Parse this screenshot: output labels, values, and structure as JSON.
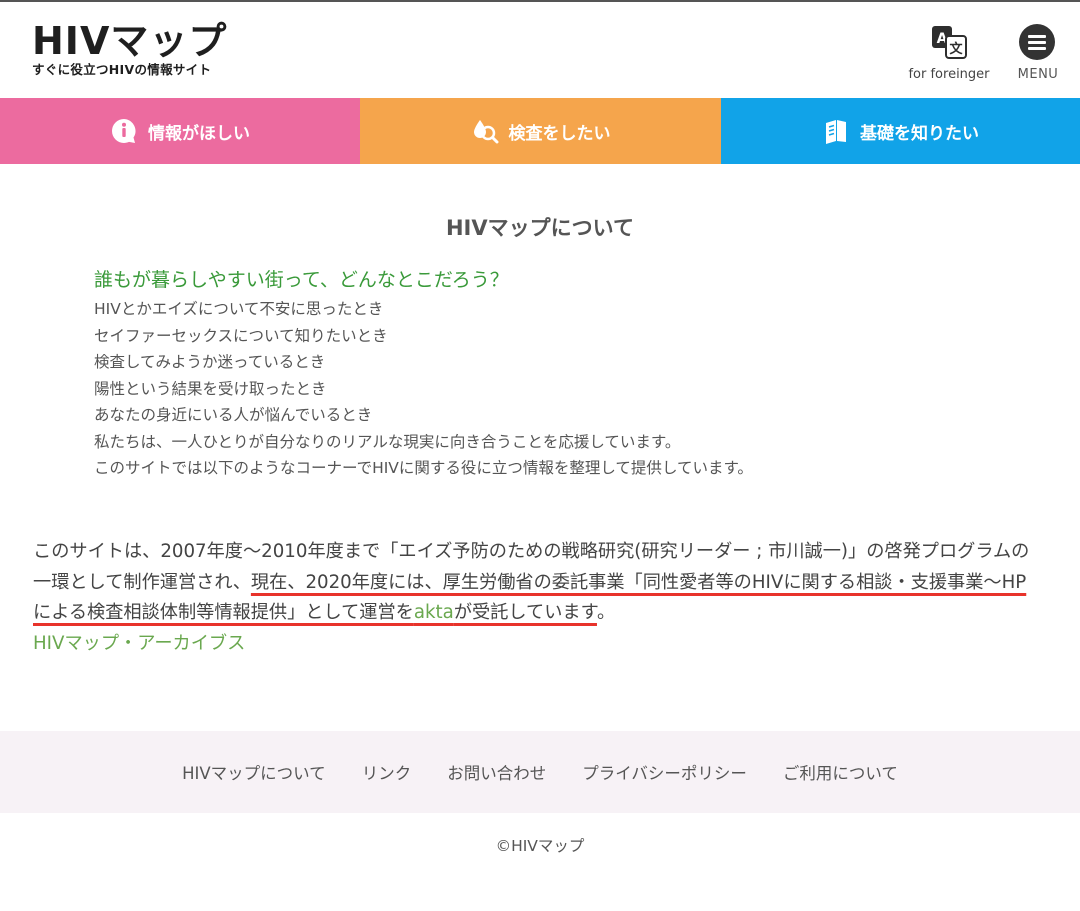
{
  "header": {
    "logo_main": "HIVマップ",
    "logo_sub": "すぐに役立つHIVの情報サイト",
    "lang_label": "for foreinger",
    "menu_label": "MENU"
  },
  "nav": {
    "tabs": [
      {
        "label": "情報がほしい",
        "color": "#ec6b9f",
        "icon": "info-icon"
      },
      {
        "label": "検査をしたい",
        "color": "#f5a54c",
        "icon": "test-search-icon"
      },
      {
        "label": "基礎を知りたい",
        "color": "#11a3e8",
        "icon": "book-icon"
      }
    ]
  },
  "main": {
    "title": "HIVマップについて",
    "intro_heading": "誰もが暮らしやすい街って、どんなとこだろう？",
    "intro_lines": [
      "HIVとかエイズについて不安に思ったとき",
      "セイファーセックスについて知りたいとき",
      "検査してみようか迷っているとき",
      "陽性という結果を受け取ったとき",
      "あなたの身近にいる人が悩んでいるとき",
      "私たちは、一人ひとりが自分なりのリアルな現実に向き合うことを応援しています。",
      "このサイトでは以下のようなコーナーでHIVに関する役に立つ情報を整理して提供しています。"
    ],
    "about_part1": "このサイトは、2007年度〜2010年度まで「エイズ予防のための戦略研究(研究リーダー ; 市川誠一)」の啓発プログラムの一環として制作運営され、",
    "about_part2": "現在、2020年度には、厚生労働省の委託事業「同性愛者等のHIVに関する相談・支援事業〜HPによる検査相談体制等情報提供」として運営を",
    "about_link": "akta",
    "about_part3": "が受託しています",
    "about_end": "。",
    "archive_link": "HIVマップ・アーカイブス"
  },
  "footer": {
    "links": [
      "HIVマップについて",
      "リンク",
      "お問い合わせ",
      "プライバシーポリシー",
      "ご利用について"
    ],
    "copyright": "©HIVマップ"
  },
  "colors": {
    "pink": "#ec6b9f",
    "orange": "#f5a54c",
    "blue": "#11a3e8",
    "green": "#3a9a3a",
    "link_green": "#6aa84f",
    "underline_red": "#e8332b"
  }
}
